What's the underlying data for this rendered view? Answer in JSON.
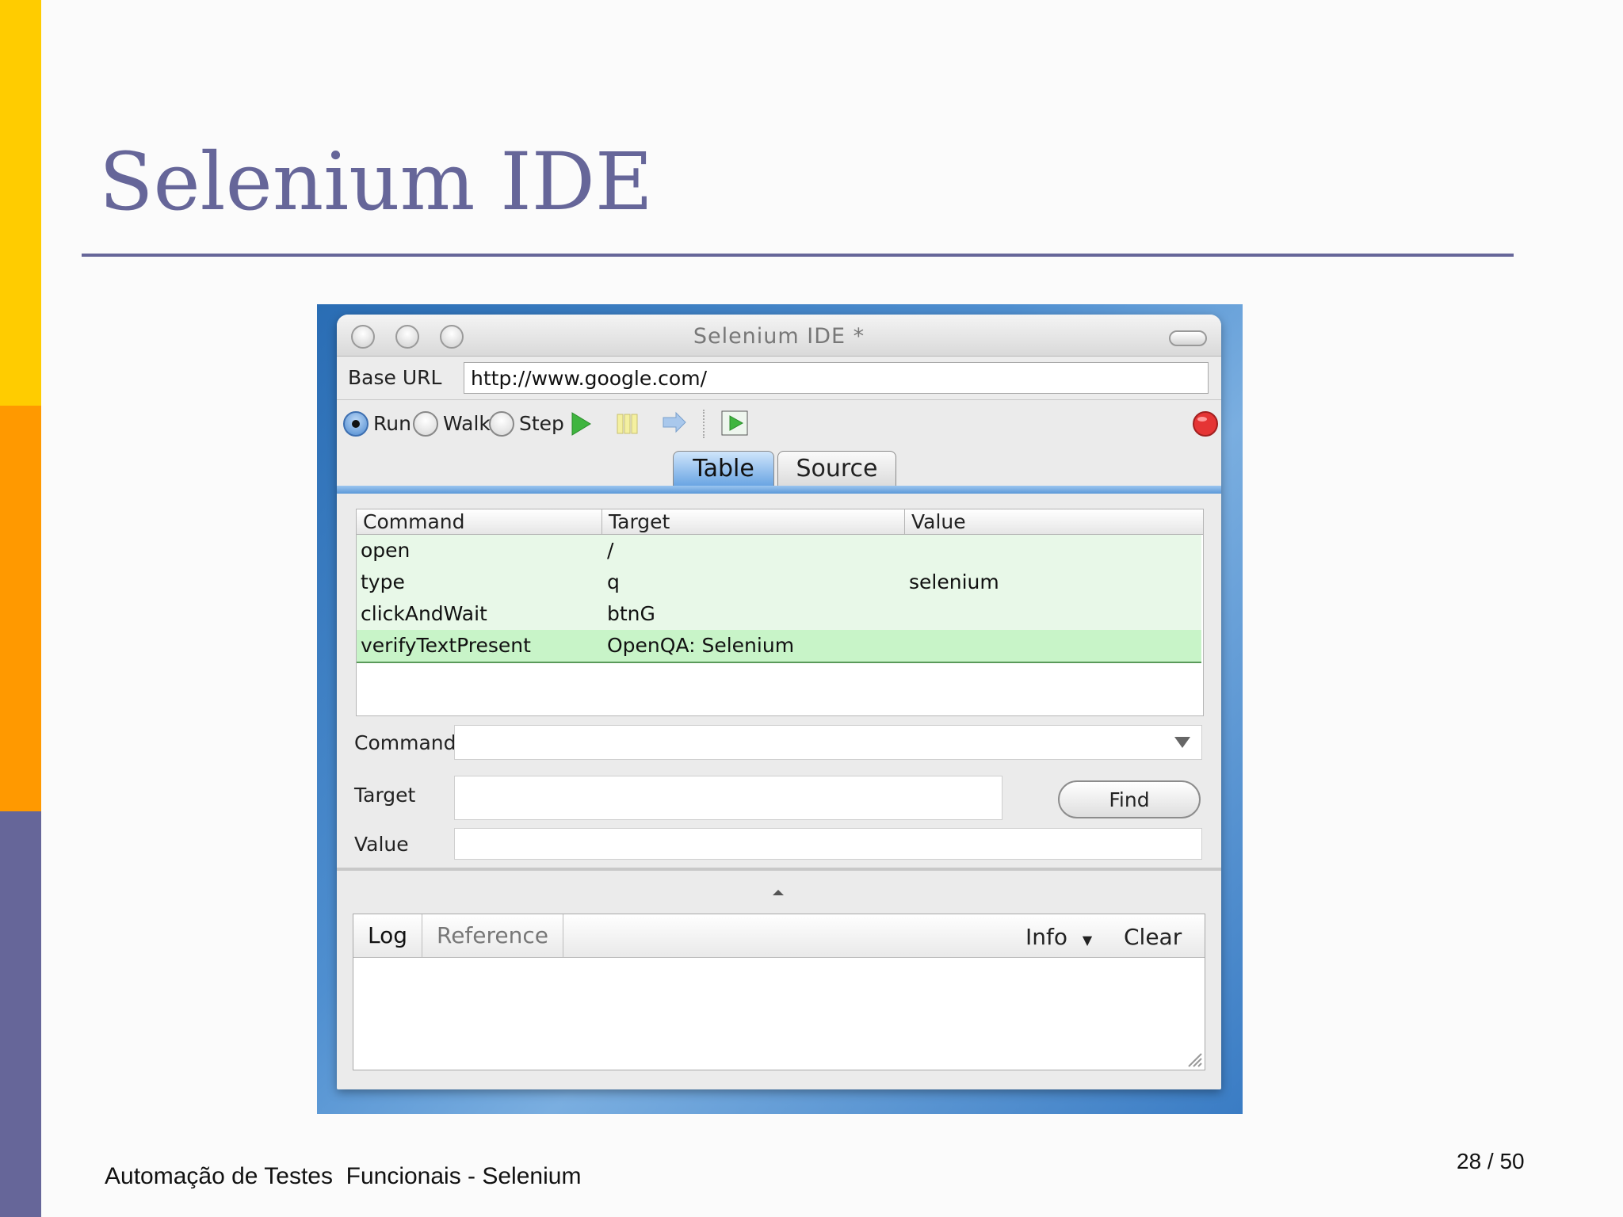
{
  "slide": {
    "title": "Selenium IDE",
    "footer": "Automação de Testes  Funcionais - Selenium",
    "page_number": "28 / 50",
    "colors": {
      "accent": "#666699",
      "strip_top": "#ffcc00",
      "strip_mid": "#ff9900",
      "strip_bottom": "#666699"
    }
  },
  "window": {
    "title": "Selenium IDE *",
    "base_url_label": "Base URL",
    "base_url_value": "http://www.google.com/",
    "modes": [
      {
        "label": "Run",
        "selected": true
      },
      {
        "label": "Walk",
        "selected": false
      },
      {
        "label": "Step",
        "selected": false
      }
    ],
    "toolbar_icons": [
      "play-icon",
      "pause-icon",
      "step-icon",
      "play-suite-icon",
      "record-icon"
    ],
    "tabs": [
      {
        "label": "Table",
        "active": true
      },
      {
        "label": "Source",
        "active": false
      }
    ],
    "table": {
      "headers": [
        "Command",
        "Target",
        "Value"
      ],
      "rows": [
        {
          "command": "open",
          "target": "/",
          "value": ""
        },
        {
          "command": "type",
          "target": "q",
          "value": "selenium"
        },
        {
          "command": "clickAndWait",
          "target": "btnG",
          "value": ""
        },
        {
          "command": "verifyTextPresent",
          "target": "OpenQA: Selenium",
          "value": ""
        }
      ],
      "selected_row": 3
    },
    "editor": {
      "command_label": "Command",
      "target_label": "Target",
      "value_label": "Value",
      "command_value": "",
      "target_value": "",
      "value_value": "",
      "find_label": "Find"
    },
    "log": {
      "tabs": [
        "Log",
        "Reference"
      ],
      "level": "Info",
      "clear_label": "Clear"
    }
  }
}
